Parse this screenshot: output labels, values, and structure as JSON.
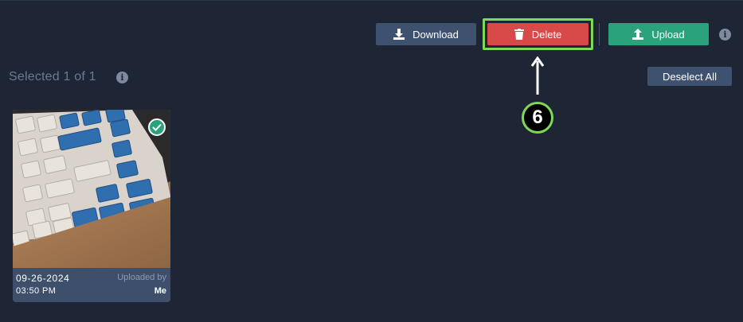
{
  "toolbar": {
    "download_label": "Download",
    "delete_label": "Delete",
    "upload_label": "Upload",
    "info_icon": "info-icon",
    "colors": {
      "download": "#3e5270",
      "delete": "#d84a4a",
      "upload": "#2aa27c",
      "highlight": "#7ed957"
    }
  },
  "selection": {
    "status_text": "Selected 1 of 1",
    "deselect_label": "Deselect All"
  },
  "annotation": {
    "step_number": "6"
  },
  "gallery": {
    "items": [
      {
        "date": "09-26-2024",
        "time": "03:50 PM",
        "uploaded_by_label": "Uploaded by",
        "owner": "Me",
        "selected": true
      }
    ]
  }
}
